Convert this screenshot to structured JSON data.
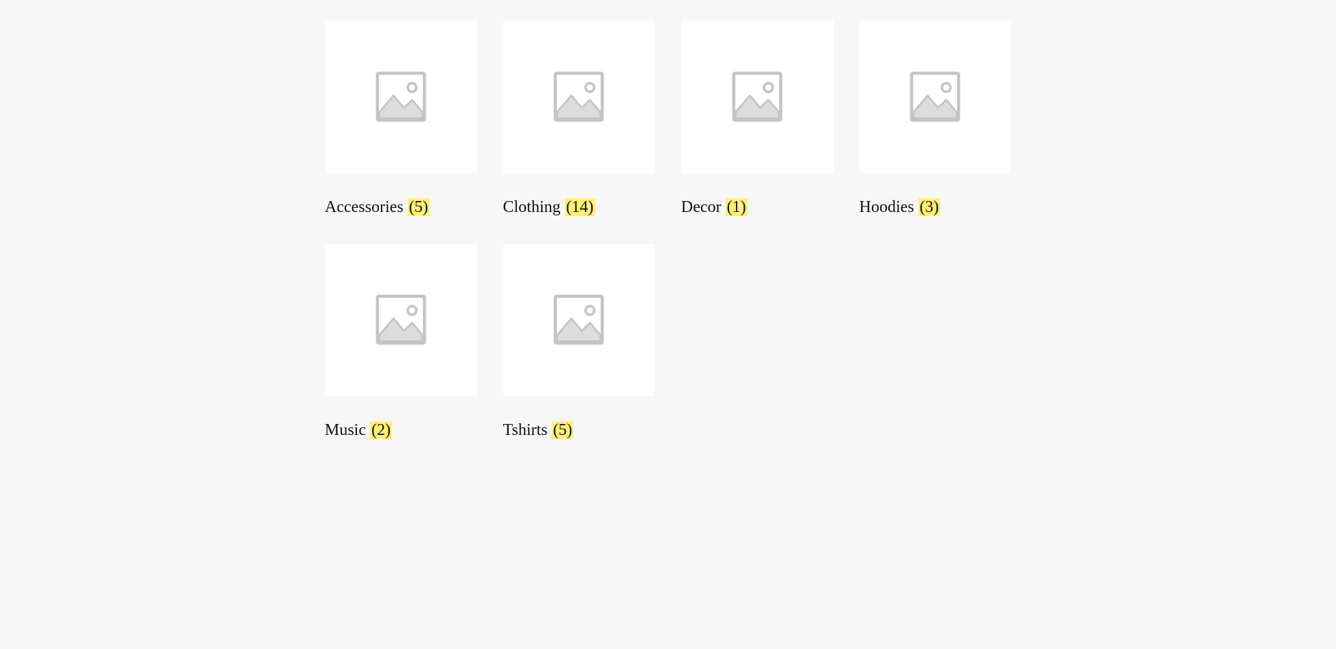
{
  "categories": [
    {
      "name": "Accessories",
      "count": "(5)"
    },
    {
      "name": "Clothing",
      "count": "(14)"
    },
    {
      "name": "Decor",
      "count": "(1)"
    },
    {
      "name": "Hoodies",
      "count": "(3)"
    },
    {
      "name": "Music",
      "count": "(2)"
    },
    {
      "name": "Tshirts",
      "count": "(5)"
    }
  ]
}
